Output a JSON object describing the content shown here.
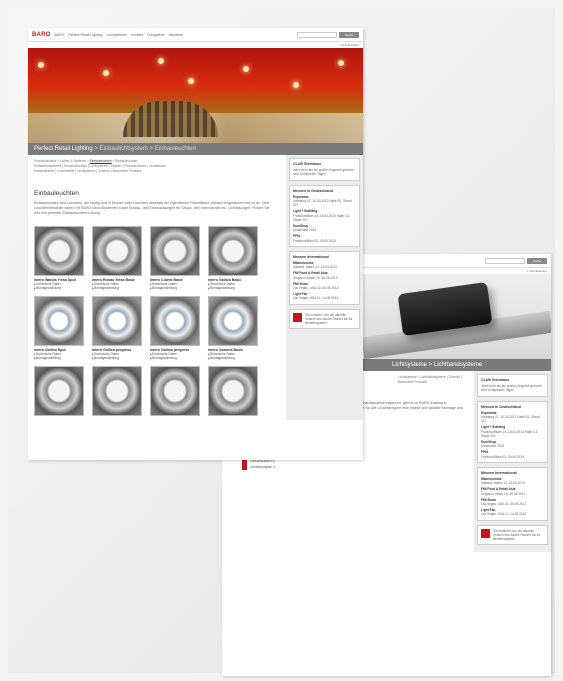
{
  "brand": {
    "logo": "BARO",
    "accent": "#c4161c"
  },
  "nav": [
    "BARO",
    "Perfect Retail Lighting",
    "Lichtsysteme",
    "Kontakt",
    "Fotogalerie",
    "Aktuelles"
  ],
  "search": {
    "button": "Suche",
    "meta": "+ Druckversion"
  },
  "screenA": {
    "band_title": "Perfect Retail Lighting",
    "band_rest": " > Einbaulichtsystem > Einbauleuchten",
    "breadcrumb": [
      "Produktionslinie > Lichter & Systeme > ",
      "Einbauleuchten",
      " > Einbauleuchten"
    ],
    "breadcrumb2": "Einbaulichtsysteme | Deckenleuchten | Lichtsysteme | Strahler | Pendelleuchten | Lichtbänder",
    "breadcrumb3": "Einbaustrahler | Leuchtmittel | Lichtsysteme | Zubehör | Besondere Produkte",
    "page_title": "Einbauleuchten",
    "intro": "Einbauleuchten sind Leuchten, die häufig dort in Decken oder Leuchten oberhalb der eigentlichen Raumfläche verbaut eingebauten und zu ist. Viele Leuchtenhersteller bieten mit BARO Deco-Systemen sowie Einbau- und Einbaulösungen für Shops, den Innenhandel etc. Lichtlösungen. Finden Sie hier Ihre perfekte Einbauleuchten-Lösung.",
    "products": [
      {
        "name": "Intero Wanda Yiesa Spot",
        "links": [
          "Technische Daten",
          "Montageanleitung"
        ]
      },
      {
        "name": "Intero Rondo Yiesa Basic",
        "links": [
          "Technische Daten",
          "Montageanleitung"
        ]
      },
      {
        "name": "Intero Cutera Basic",
        "links": [
          "Technische Daten",
          "Montageanleitung"
        ]
      },
      {
        "name": "Intero Gallica Basic",
        "links": [
          "Technische Daten",
          "Montageanleitung"
        ]
      },
      {
        "name": "Intero Gallica Spot",
        "links": [
          "Technische Daten",
          "Montageanleitung"
        ]
      },
      {
        "name": "Intero Gallica progress",
        "links": [
          "Technische Daten",
          "Montageanleitung"
        ]
      },
      {
        "name": "Intero Gallica progress",
        "links": [
          "Technische Daten",
          "Montageanleitung"
        ]
      },
      {
        "name": "Intero Garanta Basic",
        "links": [
          "Technische Daten",
          "Montageanleitung"
        ]
      }
    ]
  },
  "sidebar": {
    "news_title": "CLUB Steinhaus",
    "news_text": "Jetzt mehr als ein großes Angebot geboren sind Lichtplanen-Tagen.",
    "fairs_title": "Messen in Deutschland",
    "fairs": [
      {
        "name": "Exporama",
        "text": "Hamburg 07.-10.03.2013 Halle B1, Stand 321"
      },
      {
        "name": "Light + Building",
        "text": "Frankfurt/Main 14.-18.04.2014 Halle 4.2, Stand 210"
      },
      {
        "name": "EuroShop",
        "text": "Düsseldorf 2014"
      },
      {
        "name": "PPIA",
        "text": "Frankfurt/Main 03.-09.09.2013"
      }
    ],
    "intl_title": "Messen International",
    "intl": [
      {
        "name": "Milanolumina",
        "text": "Mailand, Italien 12.-15.04.2013"
      },
      {
        "name": "FMI Food & Retail Asia",
        "text": "Singapur, Asien 15.-18.05.2013"
      },
      {
        "name": "FMI Show",
        "text": "Las Vegas, USA 02.-05.05.2013"
      },
      {
        "name": "Light Fair",
        "text": "Las Vegas, USA 11.-14.05.2013"
      }
    ],
    "promo": "Sie kommen nun die aktuelle Version des Adobe Reader bis Ihr Betriebssystem."
  },
  "screenB": {
    "band_text": "Lichtsysteme > Lichtbandsysteme",
    "breadcrumb": "Lichtsysteme > Lichtbandsysteme | Zubehör | Besondere Produkte",
    "intro": "Die Lichtbandsysteme, die sich in BARO-Umgebung oder Leuchten als Lichtbandsysteme ergänzen, gibt es im BARO-Katalog in verschiedenen Ausführungen für BAYo und bei als Einzel- oder Bandsysteme für Alle Leuchtentypen eine leichte und variable Montage und Nutzung auf Wunsch in den geben 3 Steckkabeln erhältlich.",
    "items": [
      {
        "name": "Lichtleiste 8 L",
        "link": "Montageanleitung"
      },
      {
        "name": "Lichtleiste L",
        "link": "Montageanleitung"
      }
    ],
    "details_title": "Detaillierte Informationen",
    "pdfs": [
      "Gesamtdaten 8",
      "Lichtbandplan 1"
    ]
  }
}
